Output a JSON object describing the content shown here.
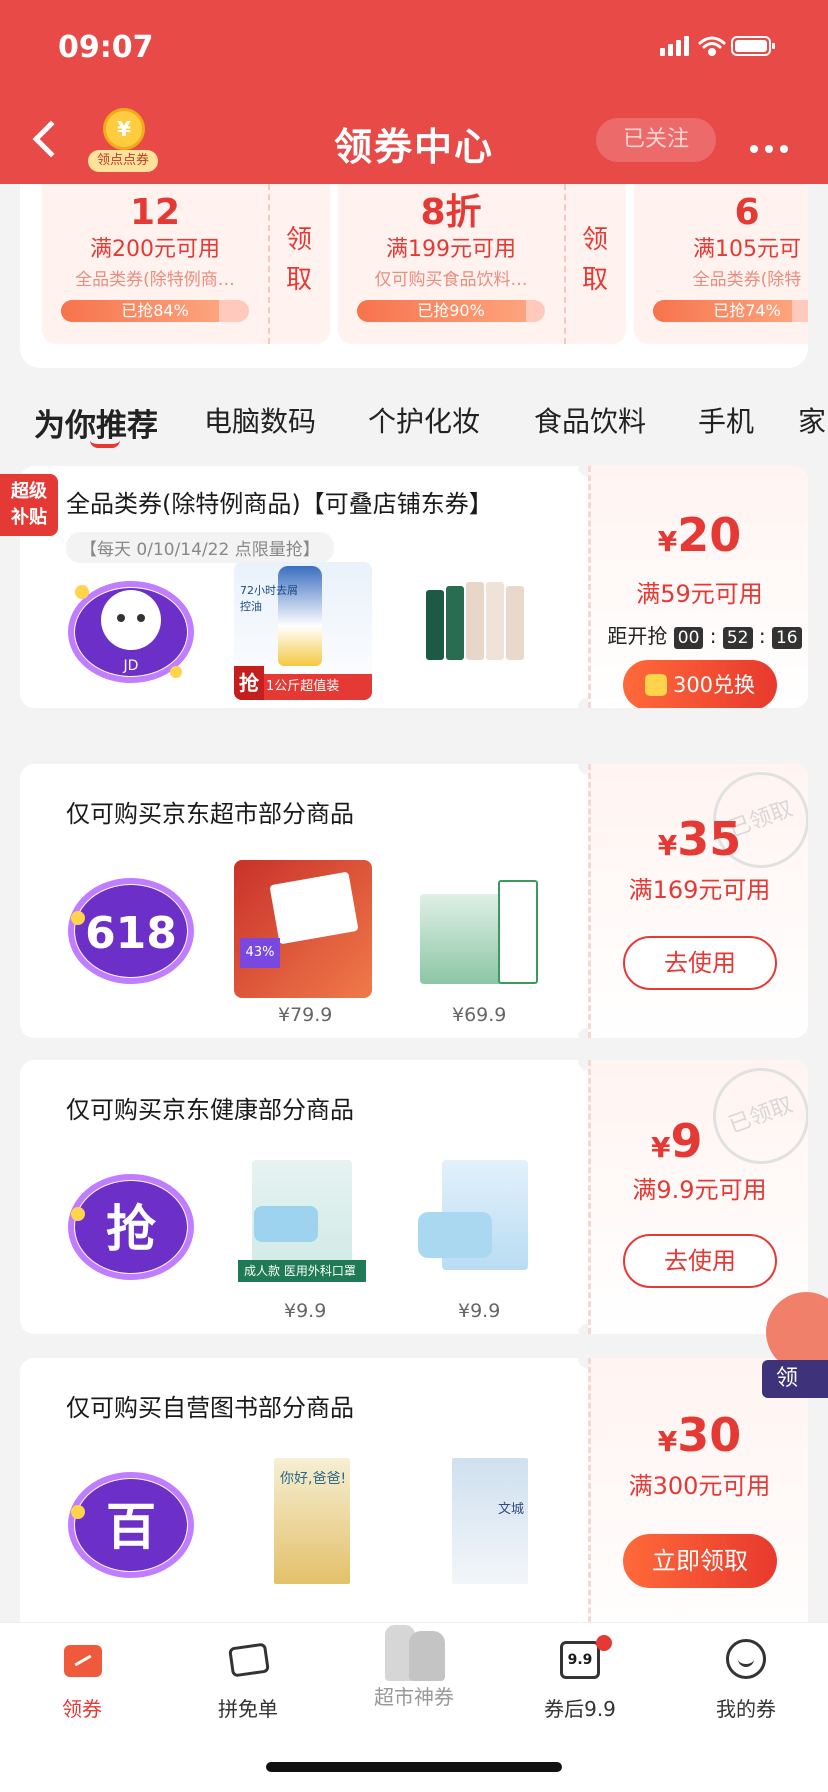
{
  "status": {
    "time": "09:07"
  },
  "header": {
    "title": "领券中心",
    "badge_label": "领点点券",
    "badge_glyph": "¥",
    "follow": "已关注"
  },
  "top_coupons": [
    {
      "amount": "12",
      "condition": "满200元可用",
      "desc": "全品类券(除特例商…",
      "claimed": "已抢84%",
      "pct": 0.84,
      "action": "领取"
    },
    {
      "amount": "8折",
      "condition": "满199元可用",
      "desc": "仅可购买食品饮料…",
      "claimed": "已抢90%",
      "pct": 0.9,
      "action": "领取"
    },
    {
      "amount": "6",
      "condition": "满105元可",
      "desc": "全品类券(除特",
      "claimed": "已抢74%",
      "pct": 0.74,
      "action": ""
    }
  ],
  "tabs": [
    "为你推荐",
    "电脑数码",
    "个护化妆",
    "食品饮料",
    "手机",
    "家"
  ],
  "super_badge": {
    "line1": "超级",
    "line2": "补贴"
  },
  "cards": [
    {
      "title": "全品类券(除特例商品)【可叠店铺东券】",
      "subtitle": "【每天 0/10/14/22 点限量抢】",
      "logo": "JD",
      "currency": "¥",
      "amount": "20",
      "condition": "满59元可用",
      "countdown_label": "距开抢",
      "countdown": [
        "00",
        "52",
        "16"
      ],
      "button": "300兑换",
      "product_tag": "抢",
      "product_tag2": "1公斤超值装",
      "product1_text": "72小时去屑控油",
      "prices": []
    },
    {
      "title": "仅可购买京东超市部分商品",
      "logo": "618",
      "currency": "¥",
      "amount": "35",
      "condition": "满169元可用",
      "button": "去使用",
      "stamp": "已领取",
      "product_text": "43%",
      "prices": [
        "¥79.9",
        "¥69.9"
      ]
    },
    {
      "title": "仅可购买京东健康部分商品",
      "logo": "抢",
      "currency": "¥",
      "amount": "9",
      "condition": "满9.9元可用",
      "button": "去使用",
      "stamp": "已领取",
      "product_text": "医用外科口罩",
      "product_text2": "成人款",
      "prices": [
        "¥9.9",
        "¥9.9"
      ]
    },
    {
      "title": "仅可购买自营图书部分商品",
      "logo": "百",
      "currency": "¥",
      "amount": "30",
      "condition": "满300元可用",
      "button": "立即领取",
      "book1": "你好,爸爸!",
      "book2": "文城",
      "prices": []
    }
  ],
  "float_widget": {
    "label": "领"
  },
  "bottom_nav": [
    {
      "label": "领券",
      "active": true
    },
    {
      "label": "拼免单",
      "active": false
    },
    {
      "label": "超市神券",
      "active": false
    },
    {
      "label": "券后9.9",
      "active": false,
      "icon_text": "9.9"
    },
    {
      "label": "我的券",
      "active": false
    }
  ],
  "colors": {
    "brand": "#e84a48",
    "accent": "#e53935",
    "bg": "#f3f3f3"
  }
}
